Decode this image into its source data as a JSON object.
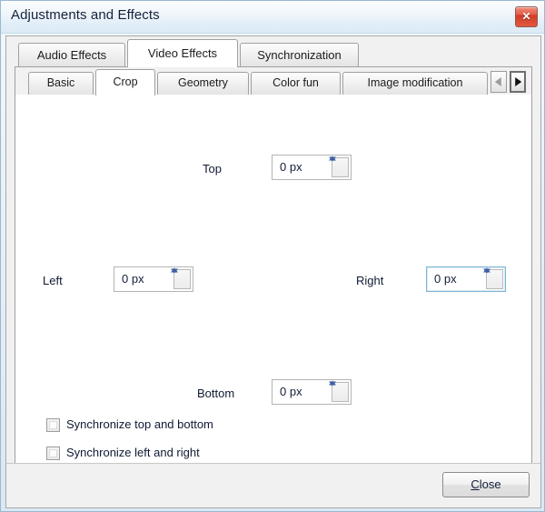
{
  "window": {
    "title": "Adjustments and Effects",
    "close_button_glyph": "close-icon",
    "close_button_label": "✕"
  },
  "main_tabs": [
    {
      "label": "Audio Effects",
      "active": false
    },
    {
      "label": "Video Effects",
      "active": true
    },
    {
      "label": "Synchronization",
      "active": false
    }
  ],
  "sub_tabs": [
    {
      "label": "Basic",
      "active": false
    },
    {
      "label": "Crop",
      "active": true
    },
    {
      "label": "Geometry",
      "active": false
    },
    {
      "label": "Color fun",
      "active": false
    },
    {
      "label": "Image modification",
      "active": false
    }
  ],
  "tab_scroll": {
    "left_label": "◀",
    "right_label": "▶"
  },
  "crop": {
    "top": {
      "label": "Top",
      "value": "0 px",
      "focused": false
    },
    "left": {
      "label": "Left",
      "value": "0 px",
      "focused": false
    },
    "right": {
      "label": "Right",
      "value": "0 px",
      "focused": true
    },
    "bottom": {
      "label": "Bottom",
      "value": "0 px",
      "focused": false
    },
    "sync_top_bottom": {
      "label": "Synchronize top and bottom",
      "checked": false
    },
    "sync_left_right": {
      "label": "Synchronize left and right",
      "checked": false
    }
  },
  "footer": {
    "close_accel": "C",
    "close_rest": "lose"
  },
  "colors": {
    "titlebar_start": "#fbfdfe",
    "titlebar_end": "#dcebf6",
    "close_red": "#d23b26",
    "focus_border": "#7eb4d6",
    "spinner_arrow": "#3f5fa5",
    "text": "#101a33"
  }
}
